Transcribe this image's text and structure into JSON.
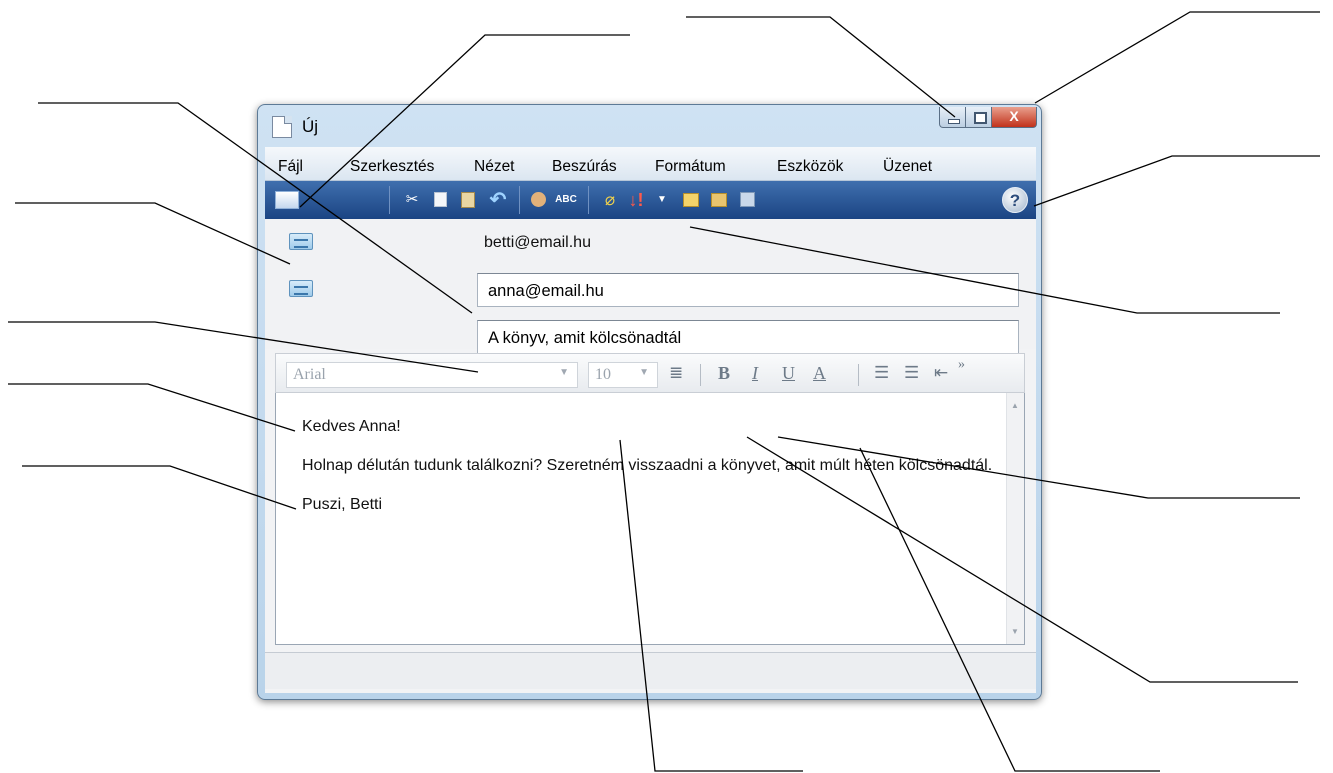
{
  "window": {
    "title": "Új",
    "close_glyph": "X"
  },
  "menu": {
    "items": [
      "Fájl",
      "Szerkesztés",
      "Nézet",
      "Beszúrás",
      "Formátum",
      "Eszközök",
      "Üzenet"
    ]
  },
  "toolbar": {
    "icons": [
      "send-icon",
      "cut-icon",
      "copy-icon",
      "paste-icon",
      "undo-icon",
      "check-names-icon",
      "spelling-icon",
      "attach-icon",
      "priority-icon",
      "sign-icon",
      "encrypt-icon",
      "offline-icon",
      "help-icon"
    ],
    "spelling_text": "ABC",
    "help_glyph": "?"
  },
  "header": {
    "from": "betti@email.hu",
    "to": "anna@email.hu",
    "subject": "A könyv, amit kölcsönadtál"
  },
  "format": {
    "font": "Arial",
    "size": "10",
    "bold": "B",
    "italic": "I",
    "underline": "U",
    "font_color": "A",
    "more": "»"
  },
  "body": {
    "greeting": "Kedves Anna!",
    "paragraph": "Holnap délután tudunk találkozni? Szeretném visszaadni a könyvet, amit múlt héten kölcsönadtál.",
    "signature": "Puszi, Betti"
  },
  "colors": {
    "toolbar_bg": "#1b4483",
    "close_button": "#c1321b",
    "window_frame": "#b9d3ea"
  }
}
